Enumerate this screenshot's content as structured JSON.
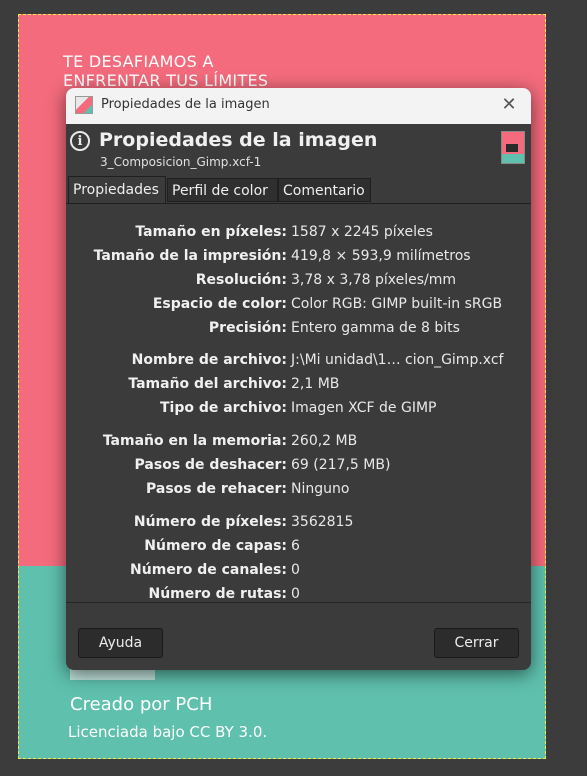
{
  "canvas": {
    "headline": "TE DESAFIAMOS A\nENFRENTAR TUS LÍMITES",
    "credit": "Creado por PCH",
    "license": "Licenciada bajo CC BY 3.0."
  },
  "dialog": {
    "window_title": "Propiedades de la imagen",
    "header_title": "Propiedades de la imagen",
    "header_subtitle": "3_Composicion_Gimp.xcf-1",
    "tabs": [
      "Propiedades",
      "Perfil de color",
      "Comentario"
    ],
    "properties": [
      {
        "label": "Tamaño en píxeles:",
        "value": "1587 x 2245 píxeles"
      },
      {
        "label": "Tamaño de la impresión:",
        "value": "419,8 × 593,9 milímetros"
      },
      {
        "label": "Resolución:",
        "value": "3,78 x 3,78 píxeles/mm"
      },
      {
        "label": "Espacio de color:",
        "value": "Color RGB: GIMP built-in sRGB"
      },
      {
        "label": "Precisión:",
        "value": "Entero gamma de 8 bits"
      },
      {
        "label": "Nombre de archivo:",
        "value": "J:\\Mi unidad\\1… cion_Gimp.xcf"
      },
      {
        "label": "Tamaño del archivo:",
        "value": "2,1 MB"
      },
      {
        "label": "Tipo de archivo:",
        "value": "Imagen XCF de GIMP"
      },
      {
        "label": "Tamaño en la memoria:",
        "value": "260,2 MB"
      },
      {
        "label": "Pasos de deshacer:",
        "value": "69 (217,5 MB)"
      },
      {
        "label": "Pasos de rehacer:",
        "value": "Ninguno"
      },
      {
        "label": "Número de píxeles:",
        "value": "3562815"
      },
      {
        "label": "Número de capas:",
        "value": "6"
      },
      {
        "label": "Número de canales:",
        "value": "0"
      },
      {
        "label": "Número de rutas:",
        "value": "0"
      }
    ],
    "help_button": "Ayuda",
    "close_button": "Cerrar"
  }
}
